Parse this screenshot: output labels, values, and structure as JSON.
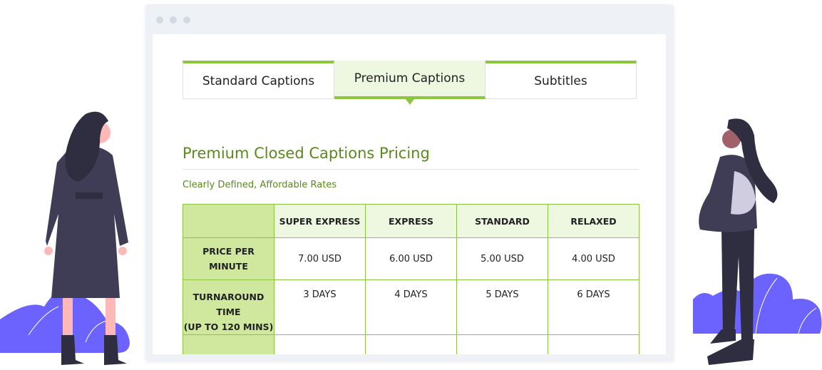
{
  "tabs": [
    {
      "label": "Standard Captions",
      "active": false
    },
    {
      "label": "Premium Captions",
      "active": true
    },
    {
      "label": "Subtitles",
      "active": false
    }
  ],
  "section": {
    "title": "Premium Closed Captions Pricing",
    "subtitle": "Clearly Defined, Affordable Rates"
  },
  "table": {
    "columns": [
      "",
      "SUPER EXPRESS",
      "EXPRESS",
      "STANDARD",
      "RELAXED"
    ],
    "rows": [
      {
        "label": "PRICE PER MINUTE",
        "values": [
          "7.00 USD",
          "6.00 USD",
          "5.00 USD",
          "4.00 USD"
        ]
      },
      {
        "label": "TURNAROUND TIME",
        "sublabel": "(UP TO 120 MINS)",
        "values": [
          "3 DAYS",
          "4 DAYS",
          "5 DAYS",
          "6 DAYS"
        ]
      }
    ]
  },
  "colors": {
    "accent_green": "#8cc63f",
    "title_green": "#5a8a1a",
    "header_green": "#cfe89d",
    "illustration_purple": "#6c63ff",
    "illustration_dark": "#3f3d56"
  }
}
